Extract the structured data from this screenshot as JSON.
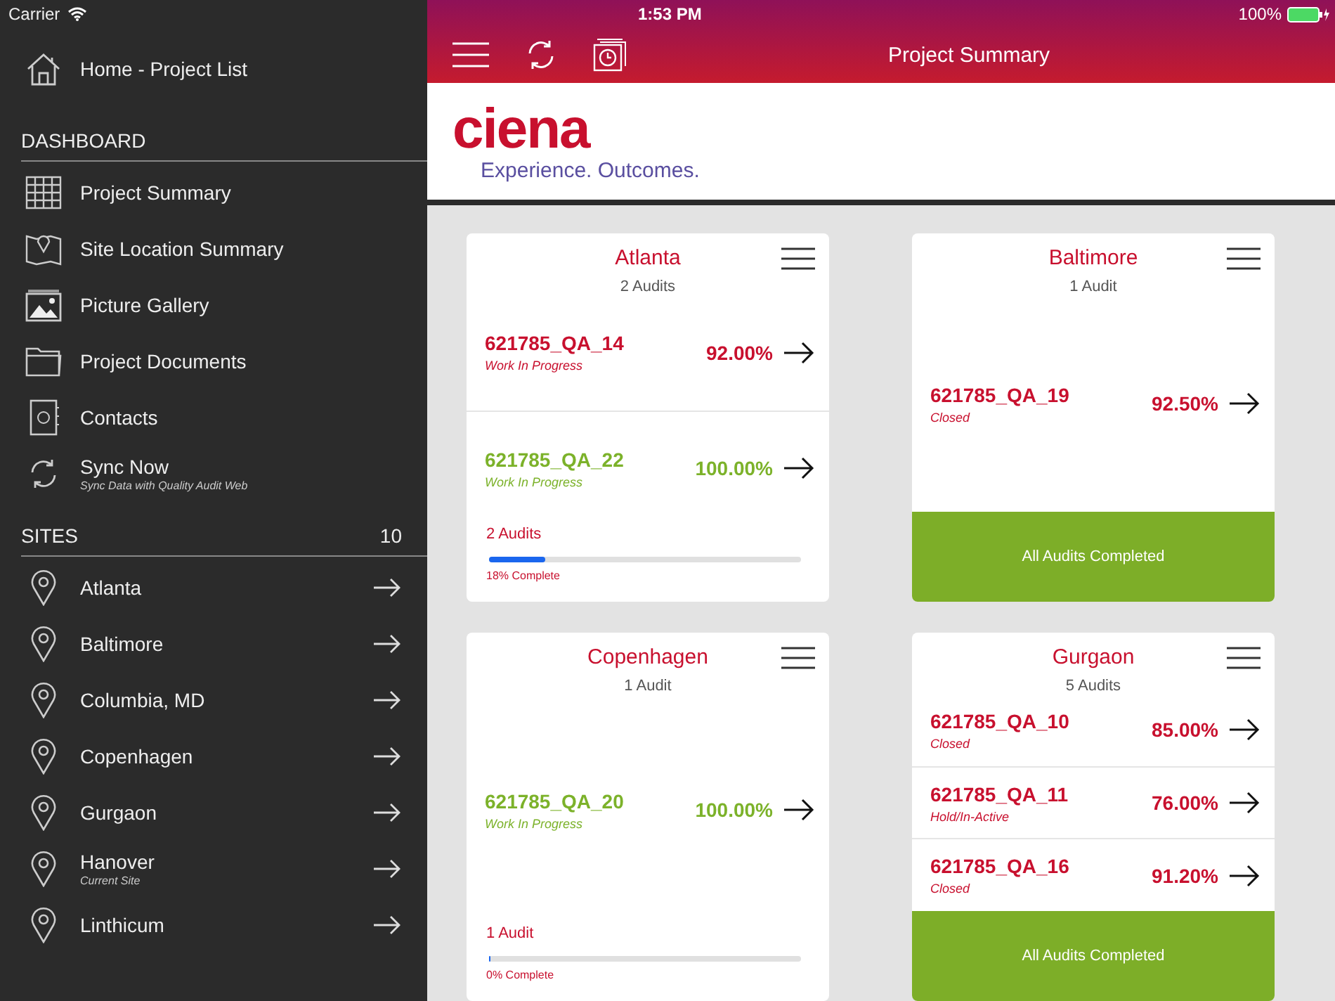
{
  "status_bar": {
    "carrier": "Carrier",
    "time": "1:53 PM",
    "battery": "100%"
  },
  "sidebar": {
    "home": {
      "label": "Home - Project List"
    },
    "dashboard": {
      "heading": "DASHBOARD",
      "items": [
        {
          "kind": "grid",
          "label": "Project Summary"
        },
        {
          "kind": "map",
          "label": "Site Location Summary"
        },
        {
          "kind": "picture",
          "label": "Picture Gallery"
        },
        {
          "kind": "folder",
          "label": "Project Documents"
        },
        {
          "kind": "contacts",
          "label": "Contacts"
        },
        {
          "kind": "sync",
          "label": "Sync Now",
          "subtitle": "Sync Data with Quality Audit Web"
        }
      ]
    },
    "sites": {
      "heading": "SITES",
      "count": "10",
      "items": [
        {
          "name": "Atlanta"
        },
        {
          "name": "Baltimore"
        },
        {
          "name": "Columbia, MD"
        },
        {
          "name": "Copenhagen"
        },
        {
          "name": "Gurgaon"
        },
        {
          "name": "Hanover",
          "subtitle": "Current Site"
        },
        {
          "name": "Linthicum"
        }
      ]
    }
  },
  "header": {
    "title": "Project Summary"
  },
  "logo": {
    "wordmark": "ciena",
    "tagline": "Experience. Outcomes."
  },
  "cards": [
    {
      "title": "Atlanta",
      "count": "2 Audits",
      "audits": [
        {
          "id": "621785_QA_14",
          "status": "Work In Progress",
          "percent": "92.00%",
          "color": "#c8102e"
        },
        {
          "id": "621785_QA_22",
          "status": "Work In Progress",
          "percent": "100.00%",
          "color": "#7cb22a"
        }
      ],
      "footer": {
        "kind": "progress",
        "label": "2 Audits",
        "level": 0.18,
        "text": "18% Complete"
      }
    },
    {
      "title": "Baltimore",
      "count": "1 Audit",
      "audits": [
        {
          "id": "621785_QA_19",
          "status": "Closed",
          "percent": "92.50%",
          "color": "#c8102e"
        }
      ],
      "footer": {
        "kind": "completed",
        "label": "All Audits Completed"
      }
    },
    {
      "title": "Copenhagen",
      "count": "1 Audit",
      "audits": [
        {
          "id": "621785_QA_20",
          "status": "Work In Progress",
          "percent": "100.00%",
          "color": "#7cb22a"
        }
      ],
      "footer": {
        "kind": "progress",
        "label": "1 Audit",
        "level": 0,
        "text": "0% Complete"
      }
    },
    {
      "title": "Gurgaon",
      "count": "5 Audits",
      "audits": [
        {
          "id": "621785_QA_10",
          "status": "Closed",
          "percent": "85.00%",
          "color": "#c8102e"
        },
        {
          "id": "621785_QA_11",
          "status": "Hold/In-Active",
          "percent": "76.00%",
          "color": "#c8102e"
        },
        {
          "id": "621785_QA_16",
          "status": "Closed",
          "percent": "91.20%",
          "color": "#c8102e"
        }
      ],
      "footer": {
        "kind": "completed",
        "label": "All Audits Completed"
      }
    }
  ]
}
